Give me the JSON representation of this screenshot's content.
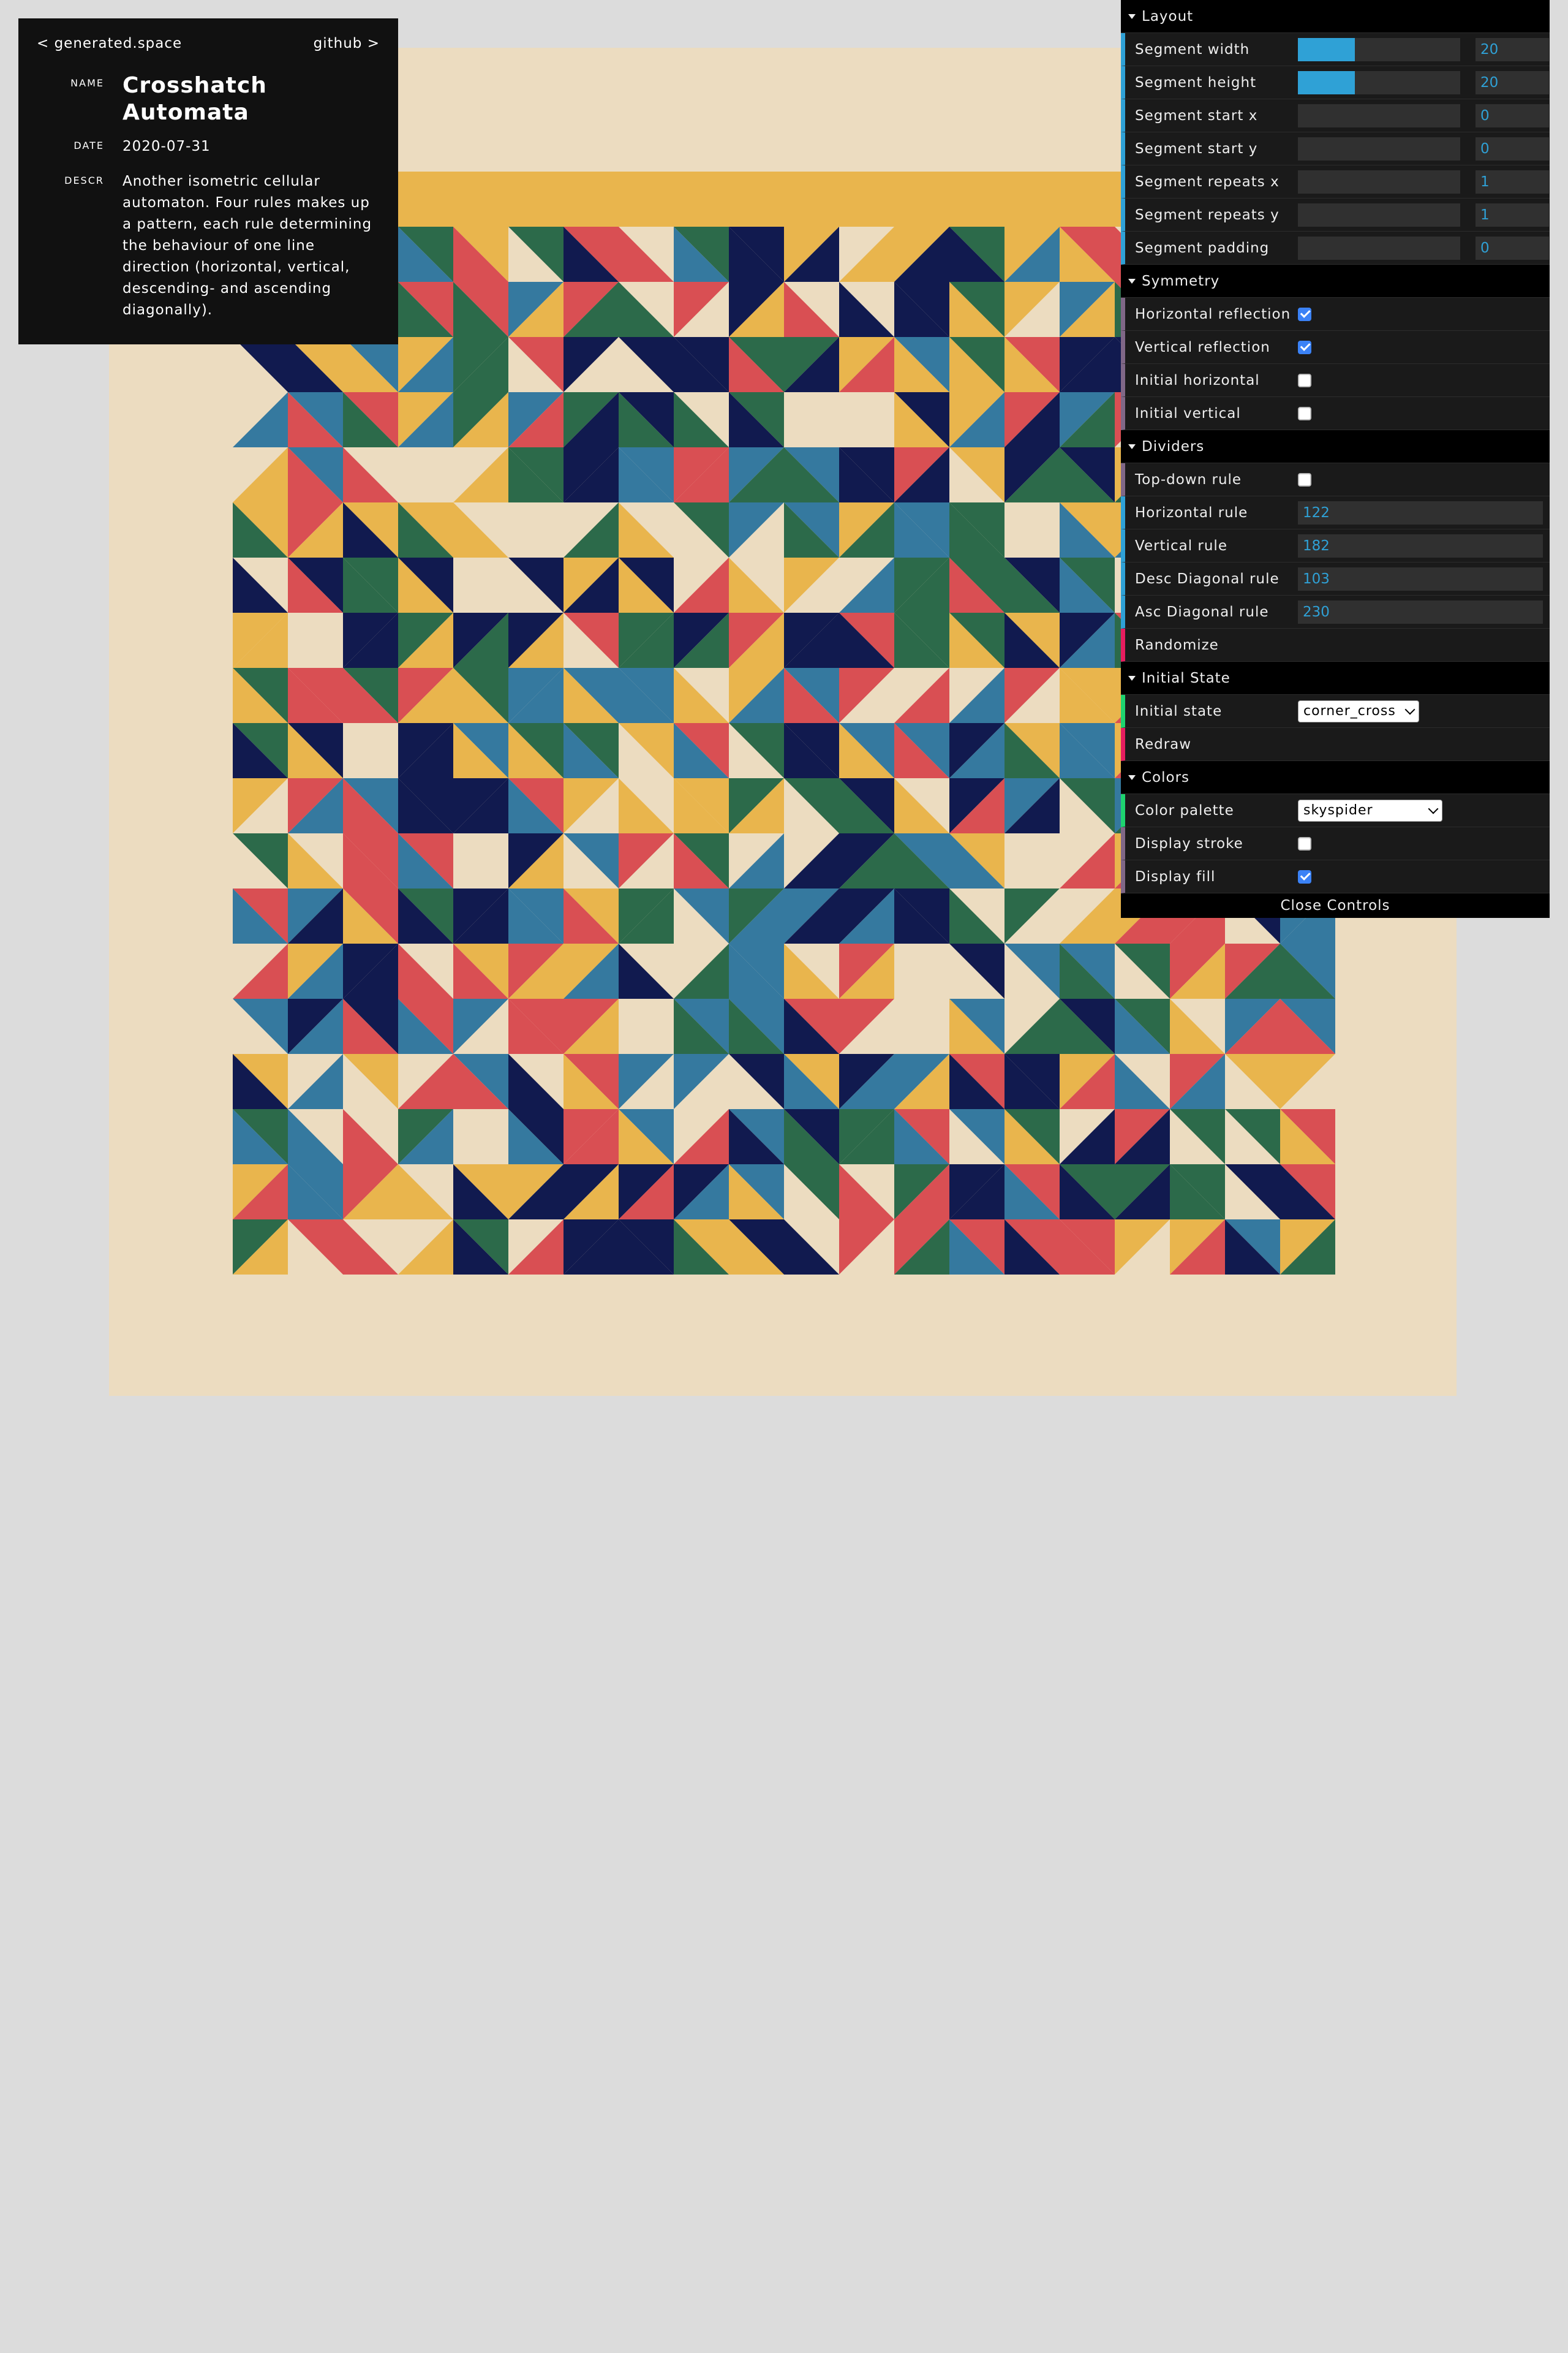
{
  "info": {
    "back_link": "< generated.space",
    "github_link": "github >",
    "name_label": "NAME",
    "name": "Crosshatch Automata",
    "date_label": "DATE",
    "date": "2020-07-31",
    "descr_label": "DESCR",
    "descr": "Another isometric cellular automaton. Four rules makes up a pattern, each rule determining the behaviour of one line direction (horizontal, vertical, descending- and ascending diagonally)."
  },
  "controls": {
    "layout": {
      "title": "Layout",
      "segment_width": {
        "label": "Segment width",
        "value": "20",
        "fraction": 0.35
      },
      "segment_height": {
        "label": "Segment height",
        "value": "20",
        "fraction": 0.35
      },
      "segment_start_x": {
        "label": "Segment start x",
        "value": "0",
        "fraction": 0
      },
      "segment_start_y": {
        "label": "Segment start y",
        "value": "0",
        "fraction": 0
      },
      "segment_repeats_x": {
        "label": "Segment repeats x",
        "value": "1",
        "fraction": 0
      },
      "segment_repeats_y": {
        "label": "Segment repeats y",
        "value": "1",
        "fraction": 0
      },
      "segment_padding": {
        "label": "Segment padding",
        "value": "0",
        "fraction": 0
      }
    },
    "symmetry": {
      "title": "Symmetry",
      "horizontal_reflection": {
        "label": "Horizontal reflection",
        "checked": true
      },
      "vertical_reflection": {
        "label": "Vertical reflection",
        "checked": true
      },
      "initial_horizontal": {
        "label": "Initial horizontal",
        "checked": false
      },
      "initial_vertical": {
        "label": "Initial vertical",
        "checked": false
      }
    },
    "dividers": {
      "title": "Dividers",
      "top_down_rule": {
        "label": "Top-down rule",
        "checked": false
      },
      "horizontal_rule": {
        "label": "Horizontal rule",
        "value": "122"
      },
      "vertical_rule": {
        "label": "Vertical rule",
        "value": "182"
      },
      "desc_diagonal_rule": {
        "label": "Desc Diagonal rule",
        "value": "103"
      },
      "asc_diagonal_rule": {
        "label": "Asc Diagonal rule",
        "value": "230"
      },
      "randomize": {
        "label": "Randomize"
      }
    },
    "initial_state": {
      "title": "Initial State",
      "initial_state": {
        "label": "Initial state",
        "value": "corner_cross"
      },
      "redraw": {
        "label": "Redraw"
      }
    },
    "colors": {
      "title": "Colors",
      "color_palette": {
        "label": "Color palette",
        "value": "skyspider"
      },
      "display_stroke": {
        "label": "Display stroke",
        "checked": false
      },
      "display_fill": {
        "label": "Display fill",
        "checked": true
      }
    },
    "close_label": "Close Controls"
  },
  "art": {
    "background": "#ecdcc0",
    "palette": [
      "#ecdcc0",
      "#e9b54d",
      "#d94f53",
      "#35799f",
      "#2c6a4a",
      "#111a4f"
    ]
  }
}
